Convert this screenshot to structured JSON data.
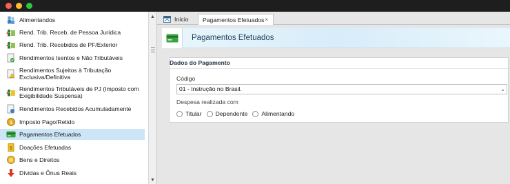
{
  "sidebar": {
    "items": [
      {
        "label": "Alimentandos",
        "icon": "people-icon"
      },
      {
        "label": "Rend. Trib. Receb. de Pessoa Jurídica",
        "icon": "money-transfer-icon"
      },
      {
        "label": "Rend. Trib. Recebidos de PF/Exterior",
        "icon": "money-transfer-icon"
      },
      {
        "label": "Rendimentos Isentos e Não Tributáveis",
        "icon": "document-check-icon"
      },
      {
        "label": "Rendimentos Sujeitos à Tributação Exclusiva/Definitiva",
        "icon": "document-warning-icon"
      },
      {
        "label": "Rendimentos Tributáveis de PJ (Imposto com Exigibilidade Suspensa)",
        "icon": "money-transfer-icon"
      },
      {
        "label": "Rendimentos Recebidos Acumuladamente",
        "icon": "document-globe-icon"
      },
      {
        "label": "Imposto Pago/Retido",
        "icon": "coin-icon"
      },
      {
        "label": "Pagamentos Efetuados",
        "icon": "credit-card-icon"
      },
      {
        "label": "Doações Efetuadas",
        "icon": "donation-icon"
      },
      {
        "label": "Bens e Direitos",
        "icon": "coins-icon"
      },
      {
        "label": "Dívidas e Ônus Reais",
        "icon": "red-arrow-down-icon"
      }
    ],
    "selected_index": 8
  },
  "tabs": [
    {
      "label": "Início",
      "icon": "home-tab-icon"
    },
    {
      "label": "Pagamentos Efetuados",
      "close": "×"
    }
  ],
  "banner": {
    "title": "Pagamentos Efetuados",
    "icon": "credit-card-icon"
  },
  "panel": {
    "title": "Dados do Pagamento",
    "codigo_label": "Código",
    "codigo_value": "01 - Instrução no Brasil.",
    "despesa_label": "Despesa realizada com",
    "radio_options": [
      "Titular",
      "Dependente",
      "Alimentando"
    ]
  },
  "colors": {
    "selected_row": "#cde6f7",
    "banner_title": "#1d3e57",
    "card_green": "#3aa341"
  }
}
